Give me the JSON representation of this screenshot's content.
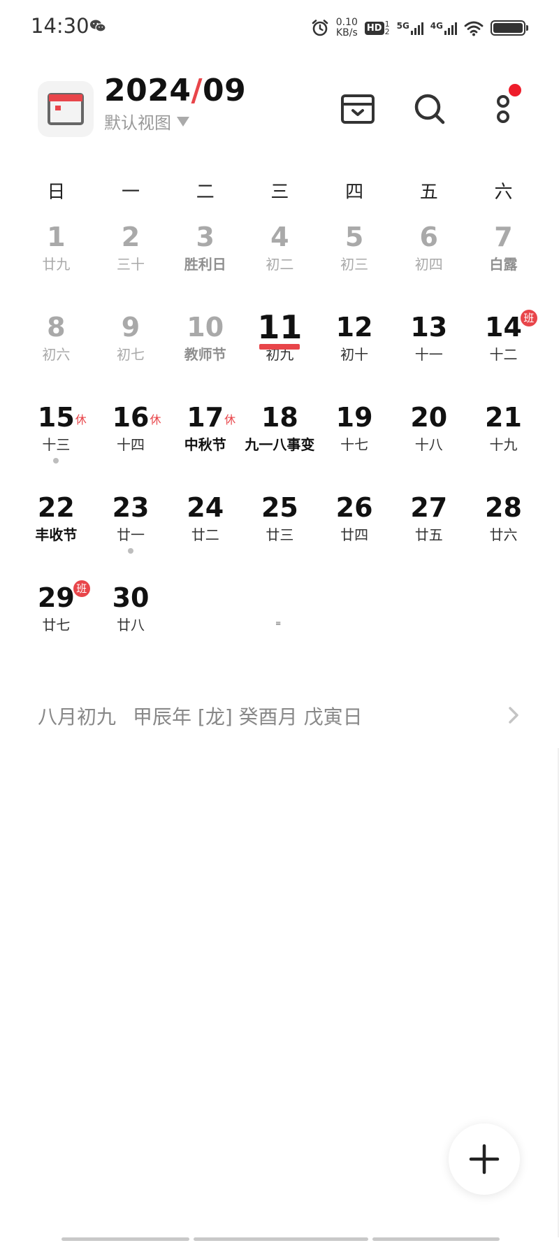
{
  "status_bar": {
    "time": "14:30",
    "net_speed_value": "0.10",
    "net_speed_unit": "KB/s",
    "hd_label": "HD",
    "hd_sub_top": "1",
    "hd_sub_bottom": "2",
    "sig1_label": "5G",
    "sig2_label": "4G",
    "battery_level": 1.0
  },
  "header": {
    "year": "2024",
    "slash": "/",
    "month": "09",
    "view_mode": "默认视图",
    "logo_color": "#e8454a"
  },
  "weekdays": [
    "日",
    "一",
    "二",
    "三",
    "四",
    "五",
    "六"
  ],
  "calendar": {
    "row1": [
      {
        "day": "1",
        "lunar": "廿九"
      },
      {
        "day": "2",
        "lunar": "三十"
      },
      {
        "day": "3",
        "lunar": "胜利日"
      },
      {
        "day": "4",
        "lunar": "初二"
      },
      {
        "day": "5",
        "lunar": "初三"
      },
      {
        "day": "6",
        "lunar": "初四"
      },
      {
        "day": "7",
        "lunar": "白露"
      }
    ],
    "row2": [
      {
        "day": "8",
        "lunar": "初六"
      },
      {
        "day": "9",
        "lunar": "初七"
      },
      {
        "day": "10",
        "lunar": "教师节"
      },
      {
        "day": "11",
        "lunar": "初九"
      },
      {
        "day": "12",
        "lunar": "初十"
      },
      {
        "day": "13",
        "lunar": "十一"
      },
      {
        "day": "14",
        "lunar": "十二",
        "badge": "班"
      }
    ],
    "row3": [
      {
        "day": "15",
        "lunar": "十三",
        "badge": "休"
      },
      {
        "day": "16",
        "lunar": "十四",
        "badge": "休"
      },
      {
        "day": "17",
        "lunar": "中秋节",
        "badge": "休"
      },
      {
        "day": "18",
        "lunar": "九一八事变"
      },
      {
        "day": "19",
        "lunar": "十七"
      },
      {
        "day": "20",
        "lunar": "十八"
      },
      {
        "day": "21",
        "lunar": "十九"
      }
    ],
    "row4": [
      {
        "day": "22",
        "lunar": "丰收节"
      },
      {
        "day": "23",
        "lunar": "廿一"
      },
      {
        "day": "24",
        "lunar": "廿二"
      },
      {
        "day": "25",
        "lunar": "廿三"
      },
      {
        "day": "26",
        "lunar": "廿四"
      },
      {
        "day": "27",
        "lunar": "廿五"
      },
      {
        "day": "28",
        "lunar": "廿六"
      }
    ],
    "row5": [
      {
        "day": "29",
        "lunar": "廿七",
        "badge": "班"
      },
      {
        "day": "30",
        "lunar": "廿八"
      }
    ],
    "small_mark": "≡"
  },
  "lunar_info": {
    "lunar_date": "八月初九",
    "ganzhi": "甲辰年 [龙] 癸酉月 戊寅日"
  },
  "icons": {
    "logo": "calendar-app-icon",
    "archive": "inbox-archive-icon",
    "search": "search-icon",
    "more": "more-dots-icon",
    "chevron": "chevron-right-icon",
    "add": "plus-icon"
  },
  "colors": {
    "accent": "#e8454a",
    "notification": "#ee1c2a"
  }
}
